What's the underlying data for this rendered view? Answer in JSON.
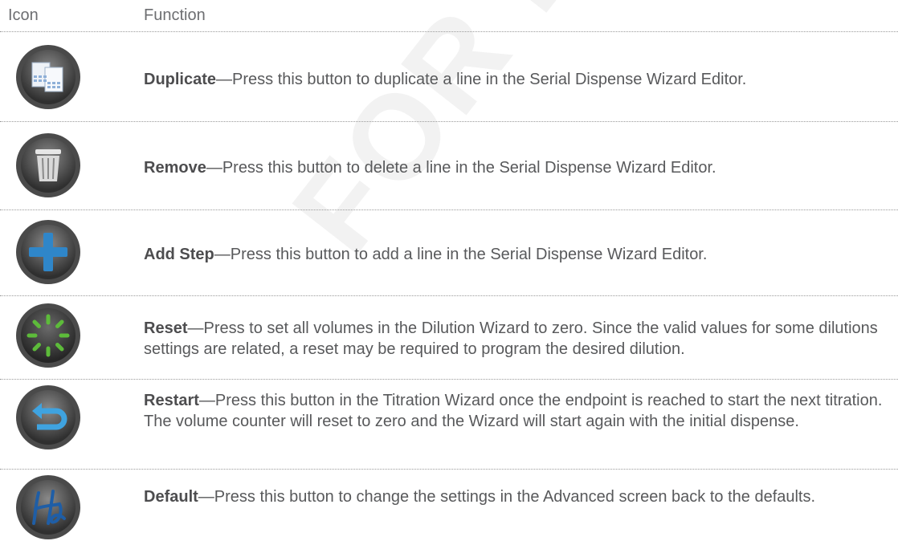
{
  "header": {
    "col_icon": "Icon",
    "col_function": "Function"
  },
  "rows": [
    {
      "icon": "duplicate-icon",
      "term": "Duplicate",
      "text": "—Press this button to duplicate a line in the Serial Dispense Wizard Editor."
    },
    {
      "icon": "trash-icon",
      "term": "Remove",
      "text": "—Press this button to delete a line in the Serial Dispense Wizard Editor."
    },
    {
      "icon": "plus-icon",
      "term": "Add Step",
      "text": "—Press this button to add a line in the Serial Dispense Wizard Editor."
    },
    {
      "icon": "reset-spinner-icon",
      "term": "Reset",
      "text": "—Press to set all volumes in the Dilution Wizard to zero. Since the valid values for some dilutions settings are related, a reset may be required to program the desired dilution."
    },
    {
      "icon": "restart-arrow-icon",
      "term": "Restart",
      "text": "—Press this button in the Titration Wizard once the endpoint is reached to start the next titration. The volume counter will reset to zero and the Wizard will start again with the initial dispense."
    },
    {
      "icon": "default-script-h-icon",
      "term": "Default",
      "text": "—Press this button to change the settings in the Advanced screen back to the defaults."
    }
  ],
  "watermark": "FOR DOUTSCHER SA",
  "colors": {
    "text": "#58595b",
    "term": "#4d4d4f",
    "plus_blue": "#2f86c9",
    "reset_green": "#5dbb3a",
    "restart_blue": "#3fa3e0",
    "default_blue": "#1f5ea6"
  }
}
